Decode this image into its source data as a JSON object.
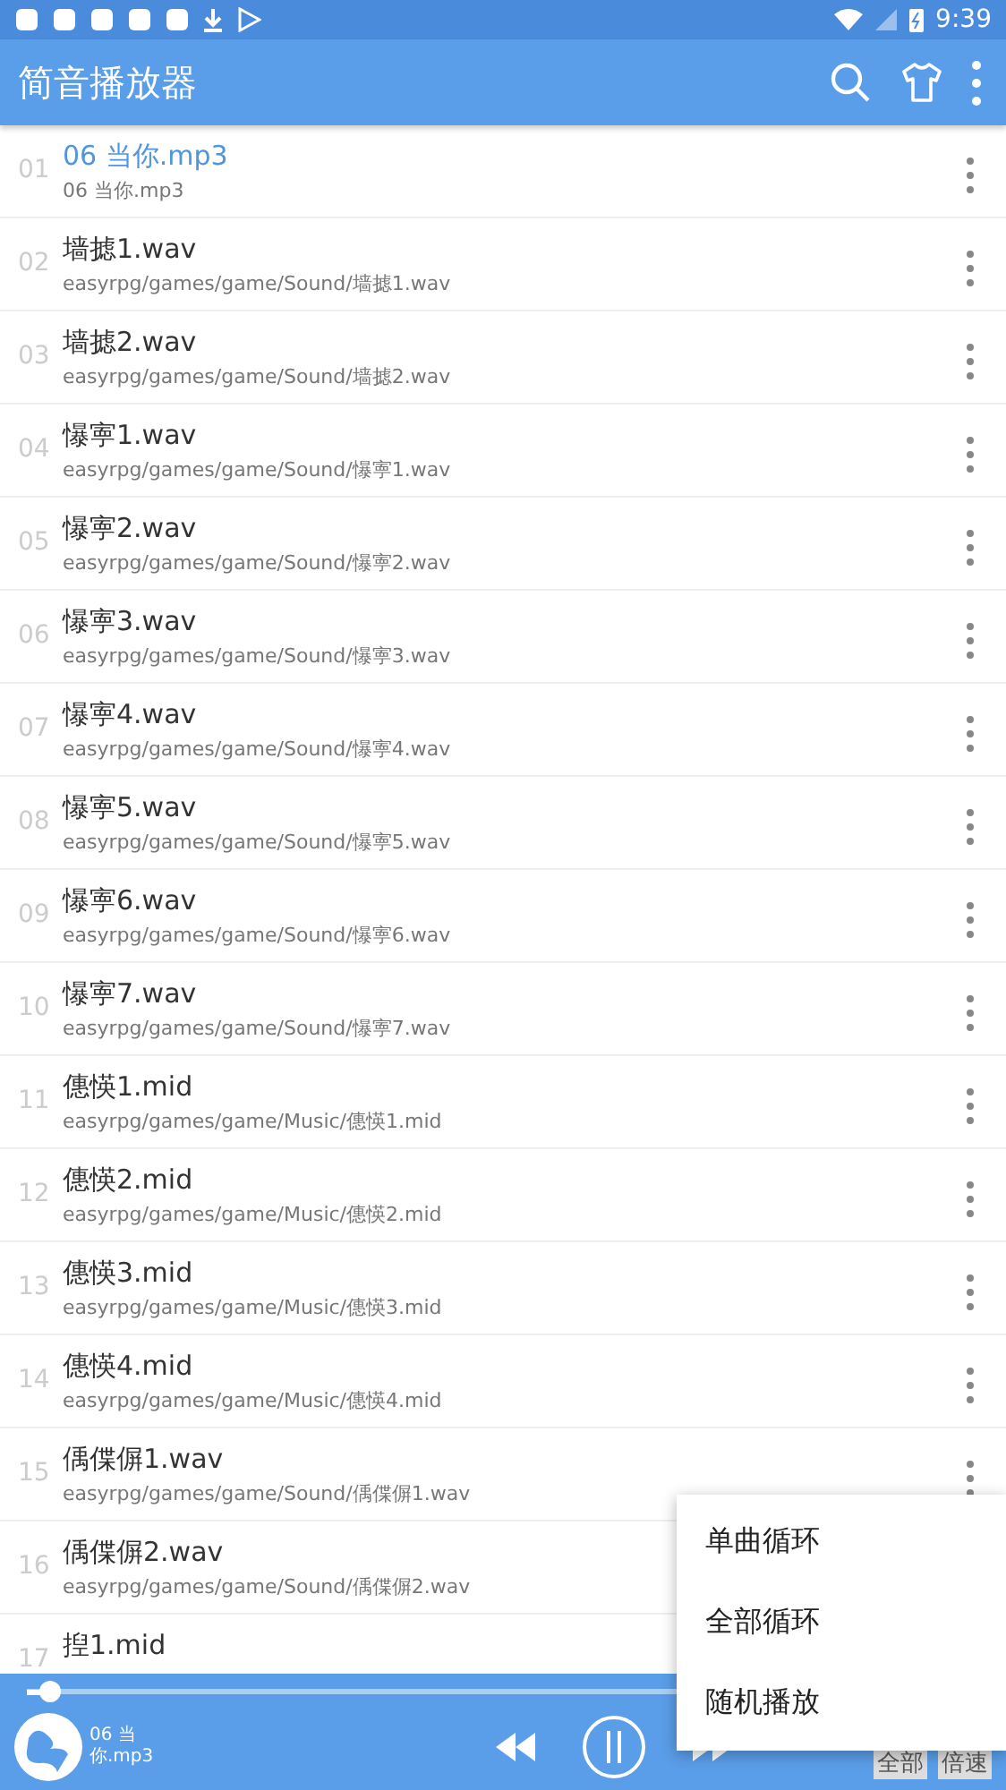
{
  "status_bar": {
    "time": "9:39"
  },
  "app_bar": {
    "title": "简音播放器"
  },
  "tracks": [
    {
      "number": "01",
      "title": "06 当你.mp3",
      "path": "06 当你.mp3",
      "selected": true
    },
    {
      "number": "02",
      "title": "墙摅1.wav",
      "path": "easyrpg/games/game/Sound/墙摅1.wav",
      "selected": false
    },
    {
      "number": "03",
      "title": "墙摅2.wav",
      "path": "easyrpg/games/game/Sound/墙摅2.wav",
      "selected": false
    },
    {
      "number": "04",
      "title": "懪寕1.wav",
      "path": "easyrpg/games/game/Sound/懪寕1.wav",
      "selected": false
    },
    {
      "number": "05",
      "title": "懪寕2.wav",
      "path": "easyrpg/games/game/Sound/懪寕2.wav",
      "selected": false
    },
    {
      "number": "06",
      "title": "懪寕3.wav",
      "path": "easyrpg/games/game/Sound/懪寕3.wav",
      "selected": false
    },
    {
      "number": "07",
      "title": "懪寕4.wav",
      "path": "easyrpg/games/game/Sound/懪寕4.wav",
      "selected": false
    },
    {
      "number": "08",
      "title": "懪寕5.wav",
      "path": "easyrpg/games/game/Sound/懪寕5.wav",
      "selected": false
    },
    {
      "number": "09",
      "title": "懪寕6.wav",
      "path": "easyrpg/games/game/Sound/懪寕6.wav",
      "selected": false
    },
    {
      "number": "10",
      "title": "懪寕7.wav",
      "path": "easyrpg/games/game/Sound/懪寕7.wav",
      "selected": false
    },
    {
      "number": "11",
      "title": "僡愥1.mid",
      "path": "easyrpg/games/game/Music/僡愥1.mid",
      "selected": false
    },
    {
      "number": "12",
      "title": "僡愥2.mid",
      "path": "easyrpg/games/game/Music/僡愥2.mid",
      "selected": false
    },
    {
      "number": "13",
      "title": "僡愥3.mid",
      "path": "easyrpg/games/game/Music/僡愥3.mid",
      "selected": false
    },
    {
      "number": "14",
      "title": "僡愥4.mid",
      "path": "easyrpg/games/game/Music/僡愥4.mid",
      "selected": false
    },
    {
      "number": "15",
      "title": "偊偞偋1.wav",
      "path": "easyrpg/games/game/Sound/偊偞偋1.wav",
      "selected": false
    },
    {
      "number": "16",
      "title": "偊偞偋2.wav",
      "path": "easyrpg/games/game/Sound/偊偞偋2.wav",
      "selected": false
    },
    {
      "number": "17",
      "title": "揑1.mid",
      "selected": false
    }
  ],
  "player": {
    "progress": {
      "level": 0.025
    },
    "now_playing": "06 当你.mp3",
    "mode_button": "全部",
    "speed_button": "倍速"
  },
  "play_mode_menu": [
    "单曲循环",
    "全部循环",
    "随机播放"
  ]
}
